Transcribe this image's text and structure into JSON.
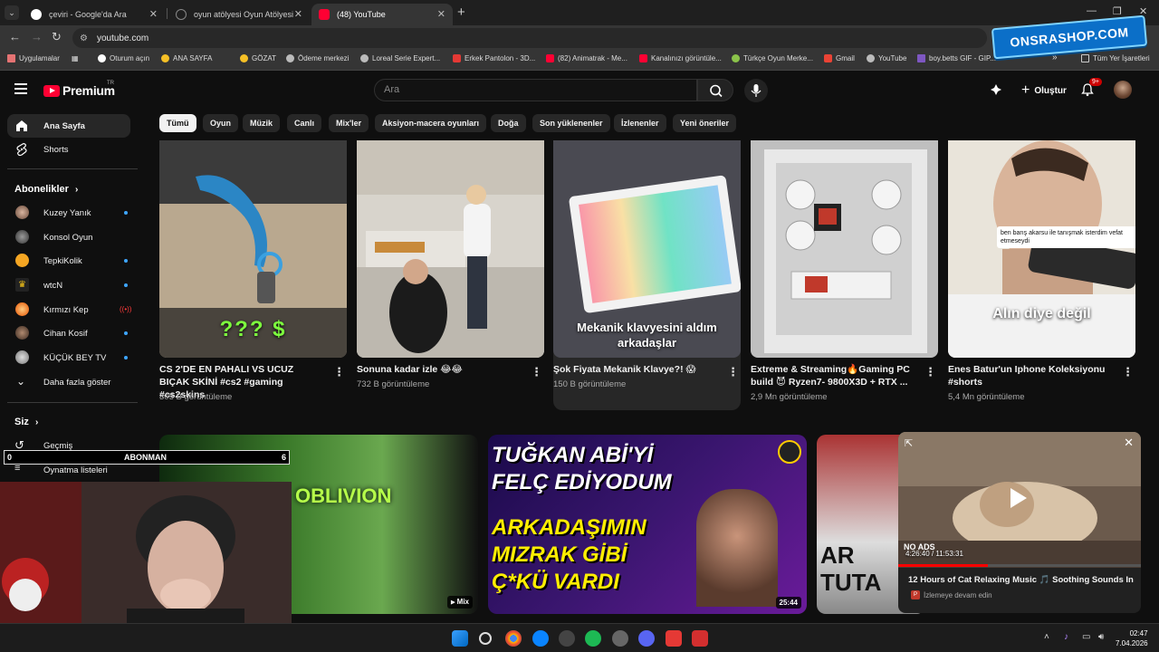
{
  "browser": {
    "tabs": [
      {
        "title": "çeviri - Google'da Ara"
      },
      {
        "title": "oyun atölyesi Oyun Atölyesi"
      },
      {
        "title": "(48) YouTube"
      }
    ],
    "url": "youtube.com",
    "bookmarks": [
      "Uygulamalar",
      "Oturum açın",
      "ANA SAYFA",
      "GÖZAT",
      "Ödeme merkezi",
      "Loreal Serie Expert...",
      "Erkek Pantolon - 3D...",
      "(82) Animatrak - Me...",
      "Kanalınızı görüntüle...",
      "Türkçe Oyun Merke...",
      "Gmail",
      "YouTube",
      "boy.betts GIF - GIP..."
    ],
    "bookmarks_more": "»",
    "bookmarks_all": "Tüm Yer İşaretleri"
  },
  "stream_overlay": {
    "shop_badge": "ONSRASHOP.COM",
    "counter_left": "0",
    "counter_label": "ABONMAN",
    "counter_right": "6"
  },
  "youtube": {
    "logo_text": "Premium",
    "logo_tr": "TR",
    "search_placeholder": "Ara",
    "create_label": "Oluştur",
    "notif_count": "9+",
    "chips": [
      "Tümü",
      "Oyun",
      "Müzik",
      "Canlı",
      "Mix'ler",
      "Aksiyon-macera oyunları",
      "Doğa",
      "Son yüklenenler",
      "İzlenenler",
      "Yeni öneriler"
    ],
    "sidebar": {
      "home": "Ana Sayfa",
      "shorts": "Shorts",
      "subs_header": "Abonelikler",
      "subs": [
        "Kuzey Yanık",
        "Konsol Oyun",
        "TepkiKolik",
        "wtcN",
        "Kırmızı Kep",
        "Cihan Kosif",
        "KÜÇÜK BEY TV"
      ],
      "show_more": "Daha fazla göster",
      "you_header": "Siz",
      "history": "Geçmiş",
      "playlists": "Oynatma listeleri"
    },
    "shorts": [
      {
        "title": "CS 2'DE EN PAHALI VS UCUZ BIÇAK SKİNİ #cs2 #gaming #cs2skins",
        "views": "305 B görüntüleme",
        "overlay": "??? $"
      },
      {
        "title": "Sonuna kadar izle 😂😂",
        "views": "732 B görüntüleme",
        "overlay": ""
      },
      {
        "title": "Şok Fiyata Mekanik Klavye?! 😱",
        "views": "150 B görüntüleme",
        "overlay": "Mekanik klavyesini aldım arkadaşlar"
      },
      {
        "title": "Extreme & Streaming🔥Gaming PC build 😈 Ryzen7- 9800X3D + RTX ...",
        "views": "2,9 Mn görüntüleme",
        "overlay": ""
      },
      {
        "title": "Enes Batur'un Iphone Koleksiyonu #shorts",
        "views": "5,4 Mn görüntüleme",
        "overlay": "Alın diye değil",
        "bubble": "ben barış akarsu ile tanışmak isterdim vefat etmeseydi"
      }
    ],
    "videos": [
      {
        "overlay": "OBLIVION",
        "badge": "Mix"
      },
      {
        "line1": "TUĞKAN ABİ'Yİ",
        "line2": "FELÇ EDİYODUM",
        "line3": "ARKADAŞIMIN",
        "line4": "MIZRAK GİBİ",
        "line5": "Ç*KÜ VARDI",
        "duration": "25:44"
      },
      {
        "overlay": "AR TUTA"
      }
    ],
    "miniplayer": {
      "title": "12 Hours of Cat Relaxing Music 🎵 Soothing Sounds In C...",
      "subtitle": "İzlemeye devam edin",
      "time": "4:26:40 / 11:53:31",
      "no_ads": "NO ADS"
    }
  },
  "taskbar": {
    "time": "02:47",
    "date": "7.04.2026"
  }
}
